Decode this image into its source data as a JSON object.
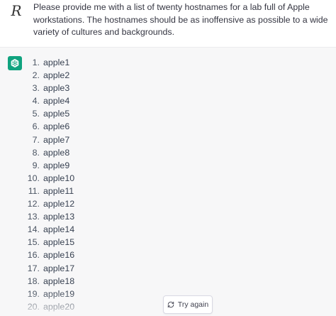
{
  "user_message": {
    "avatar_letter": "R",
    "text": "Please provide me with a list of twenty hostnames for a lab full of Apple workstations. The hostnames should be as inoffensive as possible to a wide variety of cultures and backgrounds."
  },
  "assistant_message": {
    "avatar_icon": "openai-logo-icon",
    "avatar_color": "#10a37f",
    "items": [
      {
        "num": "1.",
        "text": "apple1"
      },
      {
        "num": "2.",
        "text": "apple2"
      },
      {
        "num": "3.",
        "text": "apple3"
      },
      {
        "num": "4.",
        "text": "apple4"
      },
      {
        "num": "5.",
        "text": "apple5"
      },
      {
        "num": "6.",
        "text": "apple6"
      },
      {
        "num": "7.",
        "text": "apple7"
      },
      {
        "num": "8.",
        "text": "apple8"
      },
      {
        "num": "9.",
        "text": "apple9"
      },
      {
        "num": "10.",
        "text": "apple10"
      },
      {
        "num": "11.",
        "text": "apple11"
      },
      {
        "num": "12.",
        "text": "apple12"
      },
      {
        "num": "13.",
        "text": "apple13"
      },
      {
        "num": "14.",
        "text": "apple14"
      },
      {
        "num": "15.",
        "text": "apple15"
      },
      {
        "num": "16.",
        "text": "apple16"
      },
      {
        "num": "17.",
        "text": "apple17"
      },
      {
        "num": "18.",
        "text": "apple18"
      },
      {
        "num": "19.",
        "text": "apple19"
      },
      {
        "num": "20.",
        "text": "apple20"
      }
    ]
  },
  "actions": {
    "try_again_label": "Try again",
    "try_again_icon": "refresh-icon"
  }
}
